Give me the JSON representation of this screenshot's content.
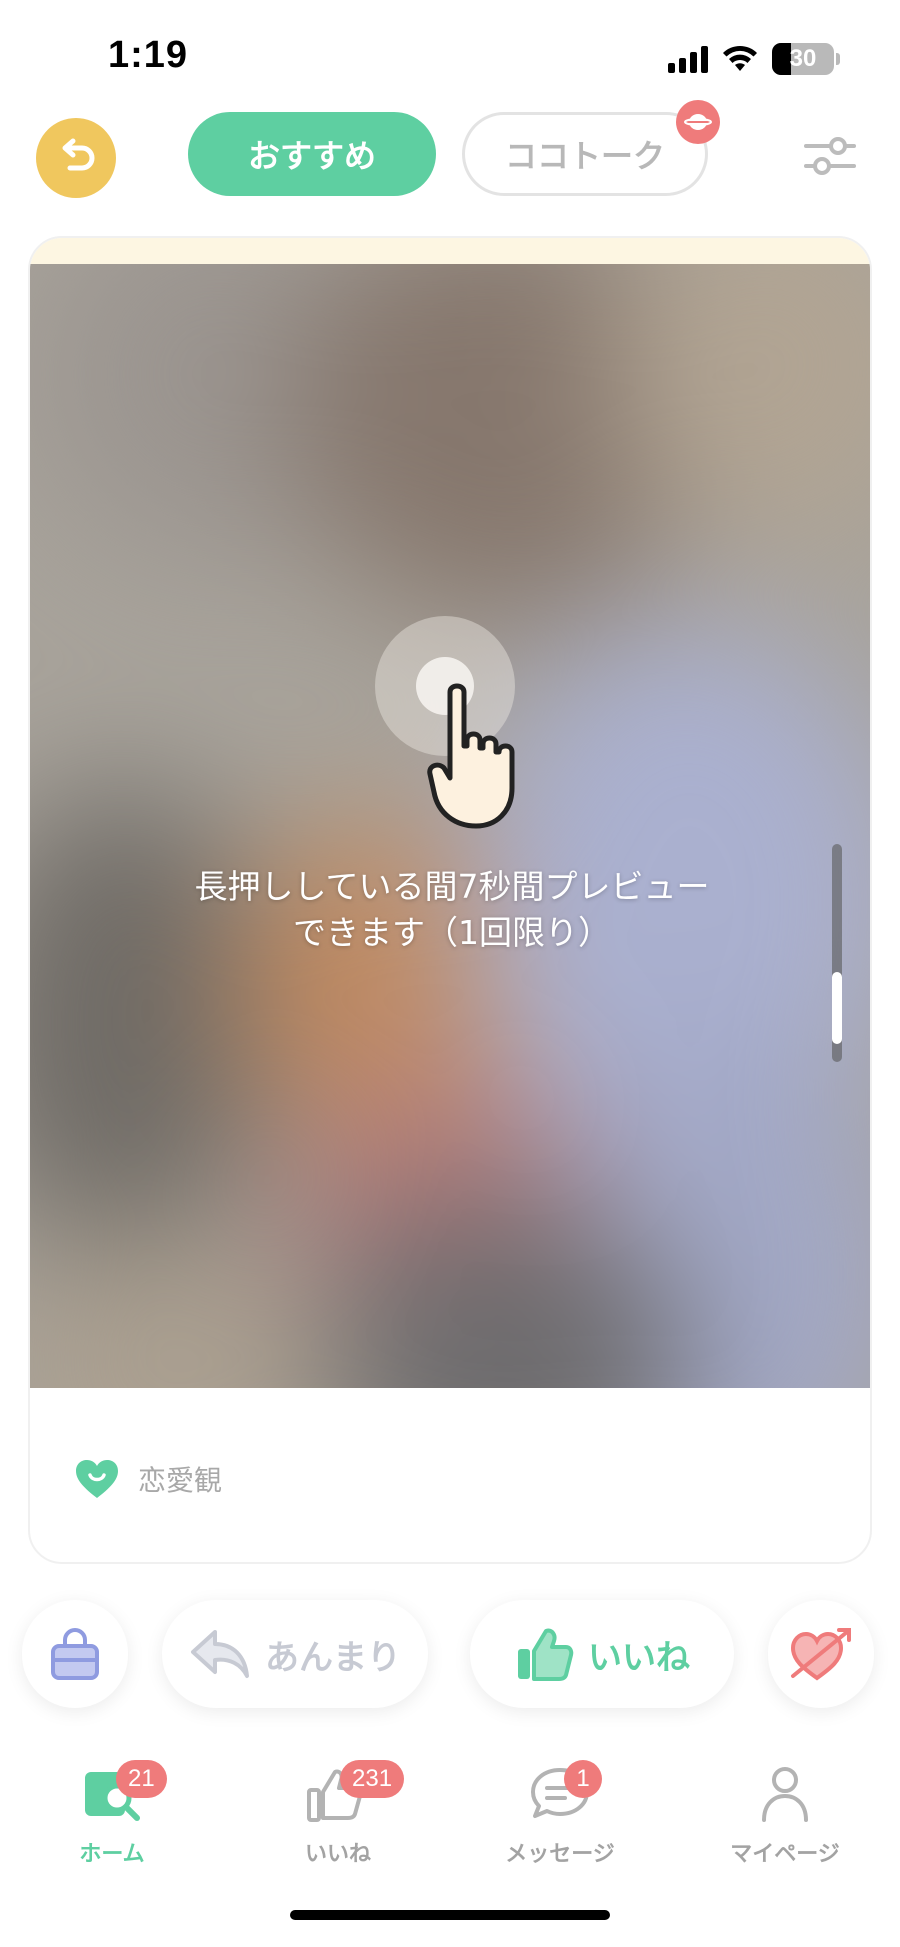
{
  "status_bar": {
    "time": "1:19",
    "battery_percent": "30",
    "icons": [
      "cellular-signal-icon",
      "wifi-icon",
      "battery-icon"
    ]
  },
  "top_nav": {
    "tabs": [
      {
        "label": "おすすめ",
        "active": true
      },
      {
        "label": "ココトーク",
        "active": false
      }
    ],
    "icons": [
      "rewind-icon",
      "notification-badge-icon",
      "filter-icon"
    ]
  },
  "card": {
    "preview_instruction": "長押ししている間7秒間プレビューできます（1回限り）",
    "info_label": "恋愛観",
    "icons": [
      "press-hold-hand-icon",
      "heart-smile-icon"
    ]
  },
  "actions": {
    "nope_label": "あんまり",
    "like_label": "いいね",
    "icons": [
      "bag-icon",
      "reply-arrow-icon",
      "thumbs-up-icon",
      "heart-arrow-icon"
    ]
  },
  "tabbar": {
    "items": [
      {
        "label": "ホーム",
        "badge": "21",
        "active": true
      },
      {
        "label": "いいね",
        "badge": "231",
        "active": false
      },
      {
        "label": "メッセージ",
        "badge": "1",
        "active": false
      },
      {
        "label": "マイページ",
        "badge": "",
        "active": false
      }
    ]
  },
  "colors": {
    "accent_green": "#5ecfa1",
    "rewind_yellow": "#f0c75e",
    "badge_red": "#ef7b7b",
    "inactive_gray": "#a3a3a3"
  }
}
